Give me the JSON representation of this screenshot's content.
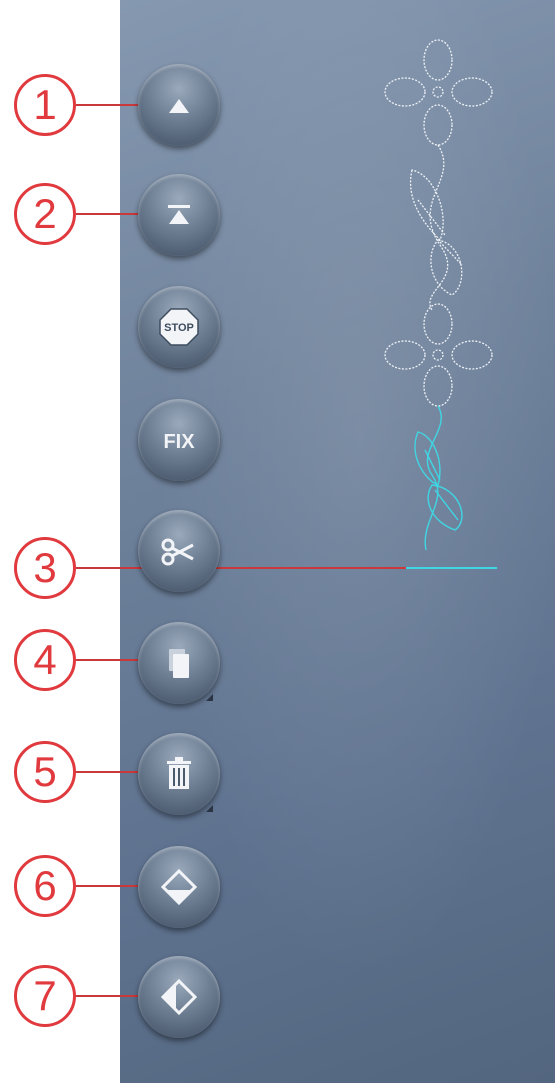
{
  "callouts": [
    "1",
    "2",
    "3",
    "4",
    "5",
    "6",
    "7"
  ],
  "buttons": {
    "stop_label": "STOP",
    "fix_label": "FIX"
  },
  "icons": [
    "triangle-up-icon",
    "triangle-top-bar-icon",
    "stop-icon",
    "fix-icon",
    "scissors-icon",
    "duplicate-icon",
    "trash-icon",
    "diamond-down-icon",
    "diamond-left-icon"
  ],
  "colors": {
    "callout": "#e03a3e",
    "stitch_done": "#ffffff",
    "stitch_current": "#3fd6e3"
  }
}
